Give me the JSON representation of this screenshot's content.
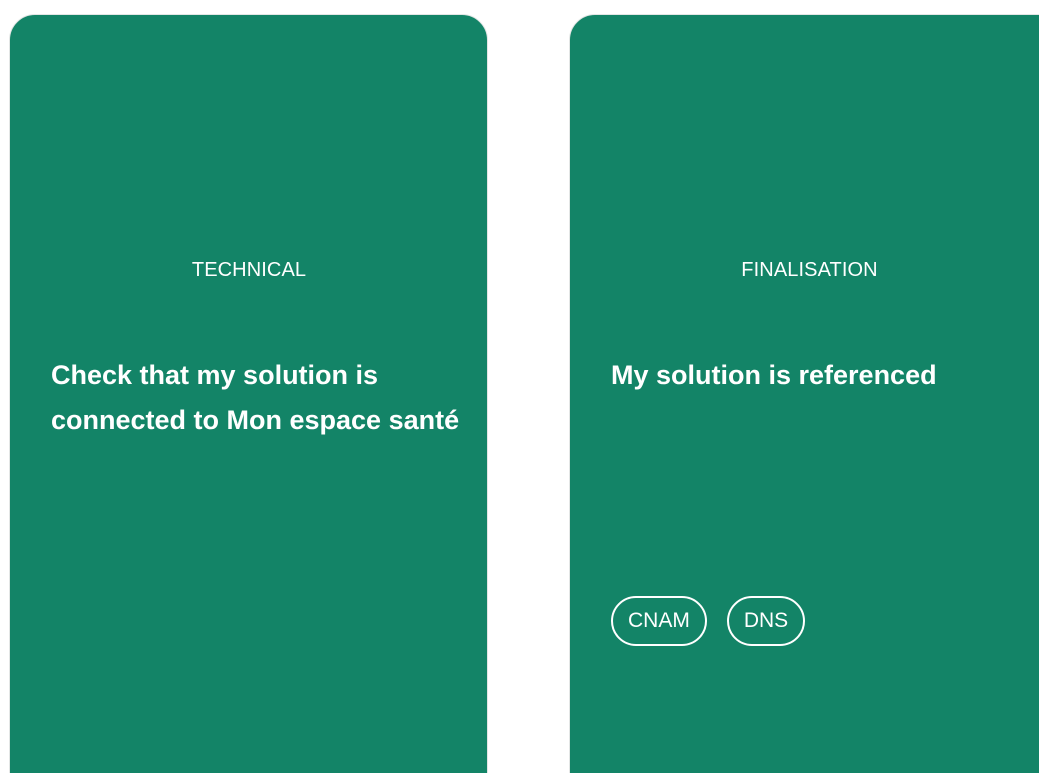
{
  "cards": [
    {
      "category": "TECHNICAL",
      "title": "Check that my solution is connected to Mon espace santé",
      "tags": []
    },
    {
      "category": "FINALISATION",
      "title": "My solution is referenced",
      "tags": [
        "CNAM",
        "DNS"
      ]
    }
  ],
  "colors": {
    "card_background": "#138467",
    "text": "#ffffff",
    "page_background": "#ffffff"
  }
}
